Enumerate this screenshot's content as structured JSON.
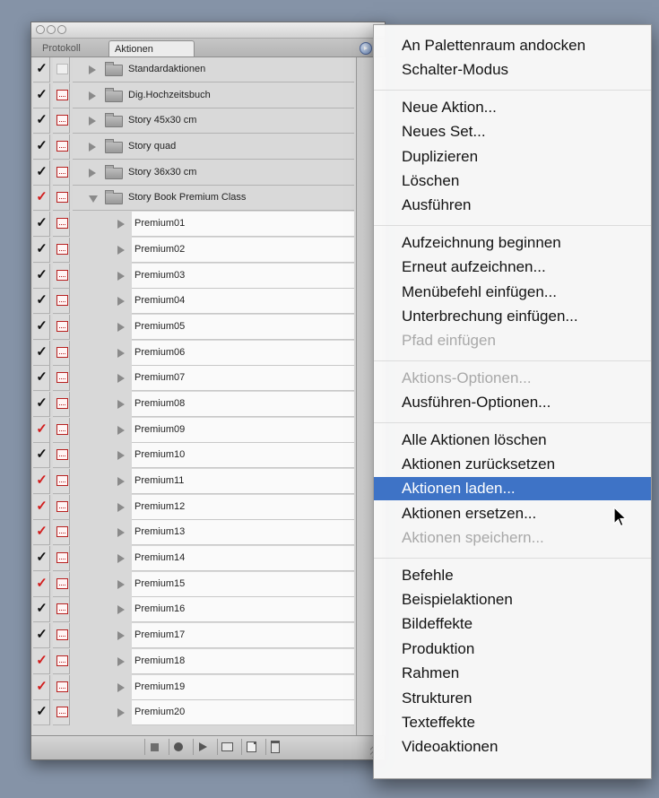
{
  "palette": {
    "tabs": [
      "Protokoll",
      "Aktionen"
    ],
    "sets": [
      {
        "name": "Standardaktionen",
        "check": "on",
        "dialog": false,
        "expanded": false
      },
      {
        "name": "Dig.Hochzeitsbuch",
        "check": "on",
        "dialog": true,
        "expanded": false
      },
      {
        "name": "Story 45x30 cm",
        "check": "on",
        "dialog": true,
        "expanded": false
      },
      {
        "name": "Story quad",
        "check": "on",
        "dialog": true,
        "expanded": false
      },
      {
        "name": "Story 36x30 cm",
        "check": "on",
        "dialog": true,
        "expanded": false
      },
      {
        "name": "Story Book Premium Class",
        "check": "red",
        "dialog": true,
        "expanded": true
      }
    ],
    "actions": [
      {
        "name": "Premium01",
        "check": "on"
      },
      {
        "name": "Premium02",
        "check": "on"
      },
      {
        "name": "Premium03",
        "check": "on"
      },
      {
        "name": "Premium04",
        "check": "on"
      },
      {
        "name": "Premium05",
        "check": "on"
      },
      {
        "name": "Premium06",
        "check": "on"
      },
      {
        "name": "Premium07",
        "check": "on"
      },
      {
        "name": "Premium08",
        "check": "on"
      },
      {
        "name": "Premium09",
        "check": "red"
      },
      {
        "name": "Premium10",
        "check": "on"
      },
      {
        "name": "Premium11",
        "check": "red"
      },
      {
        "name": "Premium12",
        "check": "red"
      },
      {
        "name": "Premium13",
        "check": "red"
      },
      {
        "name": "Premium14",
        "check": "on"
      },
      {
        "name": "Premium15",
        "check": "red"
      },
      {
        "name": "Premium16",
        "check": "on"
      },
      {
        "name": "Premium17",
        "check": "on"
      },
      {
        "name": "Premium18",
        "check": "red"
      },
      {
        "name": "Premium19",
        "check": "red"
      },
      {
        "name": "Premium20",
        "check": "on"
      }
    ],
    "bottom_buttons": [
      "stop-icon",
      "record-icon",
      "play-icon",
      "new-set-icon",
      "new-action-icon",
      "trash-icon"
    ]
  },
  "menu": {
    "highlight_color": "#3e73c6",
    "groups": [
      [
        {
          "label": "An Palettenraum andocken",
          "enabled": true
        },
        {
          "label": "Schalter-Modus",
          "enabled": true
        }
      ],
      [
        {
          "label": "Neue Aktion...",
          "enabled": true
        },
        {
          "label": "Neues Set...",
          "enabled": true
        },
        {
          "label": "Duplizieren",
          "enabled": true
        },
        {
          "label": "Löschen",
          "enabled": true
        },
        {
          "label": "Ausführen",
          "enabled": true
        }
      ],
      [
        {
          "label": "Aufzeichnung beginnen",
          "enabled": true
        },
        {
          "label": "Erneut aufzeichnen...",
          "enabled": true
        },
        {
          "label": "Menübefehl einfügen...",
          "enabled": true
        },
        {
          "label": "Unterbrechung einfügen...",
          "enabled": true
        },
        {
          "label": "Pfad einfügen",
          "enabled": false
        }
      ],
      [
        {
          "label": "Aktions-Optionen...",
          "enabled": false
        },
        {
          "label": "Ausführen-Optionen...",
          "enabled": true
        }
      ],
      [
        {
          "label": "Alle Aktionen löschen",
          "enabled": true
        },
        {
          "label": "Aktionen zurücksetzen",
          "enabled": true
        },
        {
          "label": "Aktionen laden...",
          "enabled": true,
          "highlighted": true
        },
        {
          "label": "Aktionen ersetzen...",
          "enabled": true
        },
        {
          "label": "Aktionen speichern...",
          "enabled": false
        }
      ],
      [
        {
          "label": "Befehle",
          "enabled": true
        },
        {
          "label": "Beispielaktionen",
          "enabled": true
        },
        {
          "label": "Bildeffekte",
          "enabled": true
        },
        {
          "label": "Produktion",
          "enabled": true
        },
        {
          "label": "Rahmen",
          "enabled": true
        },
        {
          "label": "Strukturen",
          "enabled": true
        },
        {
          "label": "Texteffekte",
          "enabled": true
        },
        {
          "label": "Videoaktionen",
          "enabled": true
        }
      ]
    ]
  }
}
